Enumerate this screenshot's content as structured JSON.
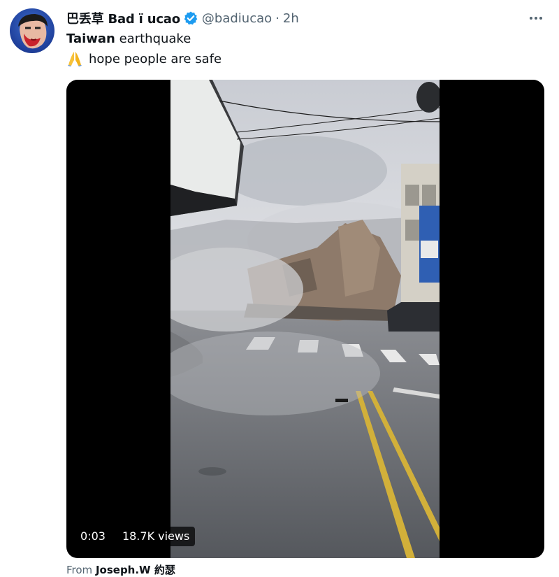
{
  "tweet": {
    "display_name": "巴丢草 Bad ï ucao",
    "handle": "@badiucao",
    "separator": "·",
    "timestamp": "2h",
    "verified": true,
    "text_bold": "Taiwan",
    "text_rest": " earthquake",
    "pray_emoji": "🙏",
    "text_line2": "hope people are safe"
  },
  "video": {
    "time_elapsed": "0:03",
    "views": "18.7K views"
  },
  "source": {
    "prefix": "From",
    "name": "Joseph.W 約瑟"
  },
  "colors": {
    "verified": "#1d9bf0",
    "secondary_text": "#536471",
    "primary_text": "#0f1419"
  },
  "icons": [
    "avatar",
    "verified-badge-icon",
    "more-dots-icon",
    "pray-emoji-icon"
  ]
}
